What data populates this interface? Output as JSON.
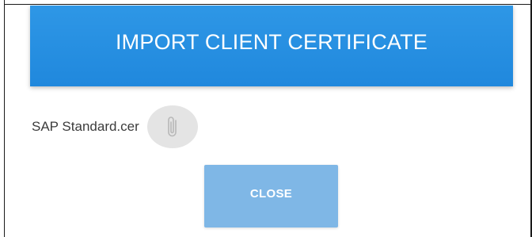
{
  "dialog": {
    "title": "IMPORT CLIENT CERTIFICATE",
    "header_color": "#2a90e2"
  },
  "file": {
    "name": "SAP Standard.cer",
    "attach_icon": "paperclip-icon"
  },
  "actions": {
    "close_label": "CLOSE",
    "close_color": "#7fb7e6"
  }
}
